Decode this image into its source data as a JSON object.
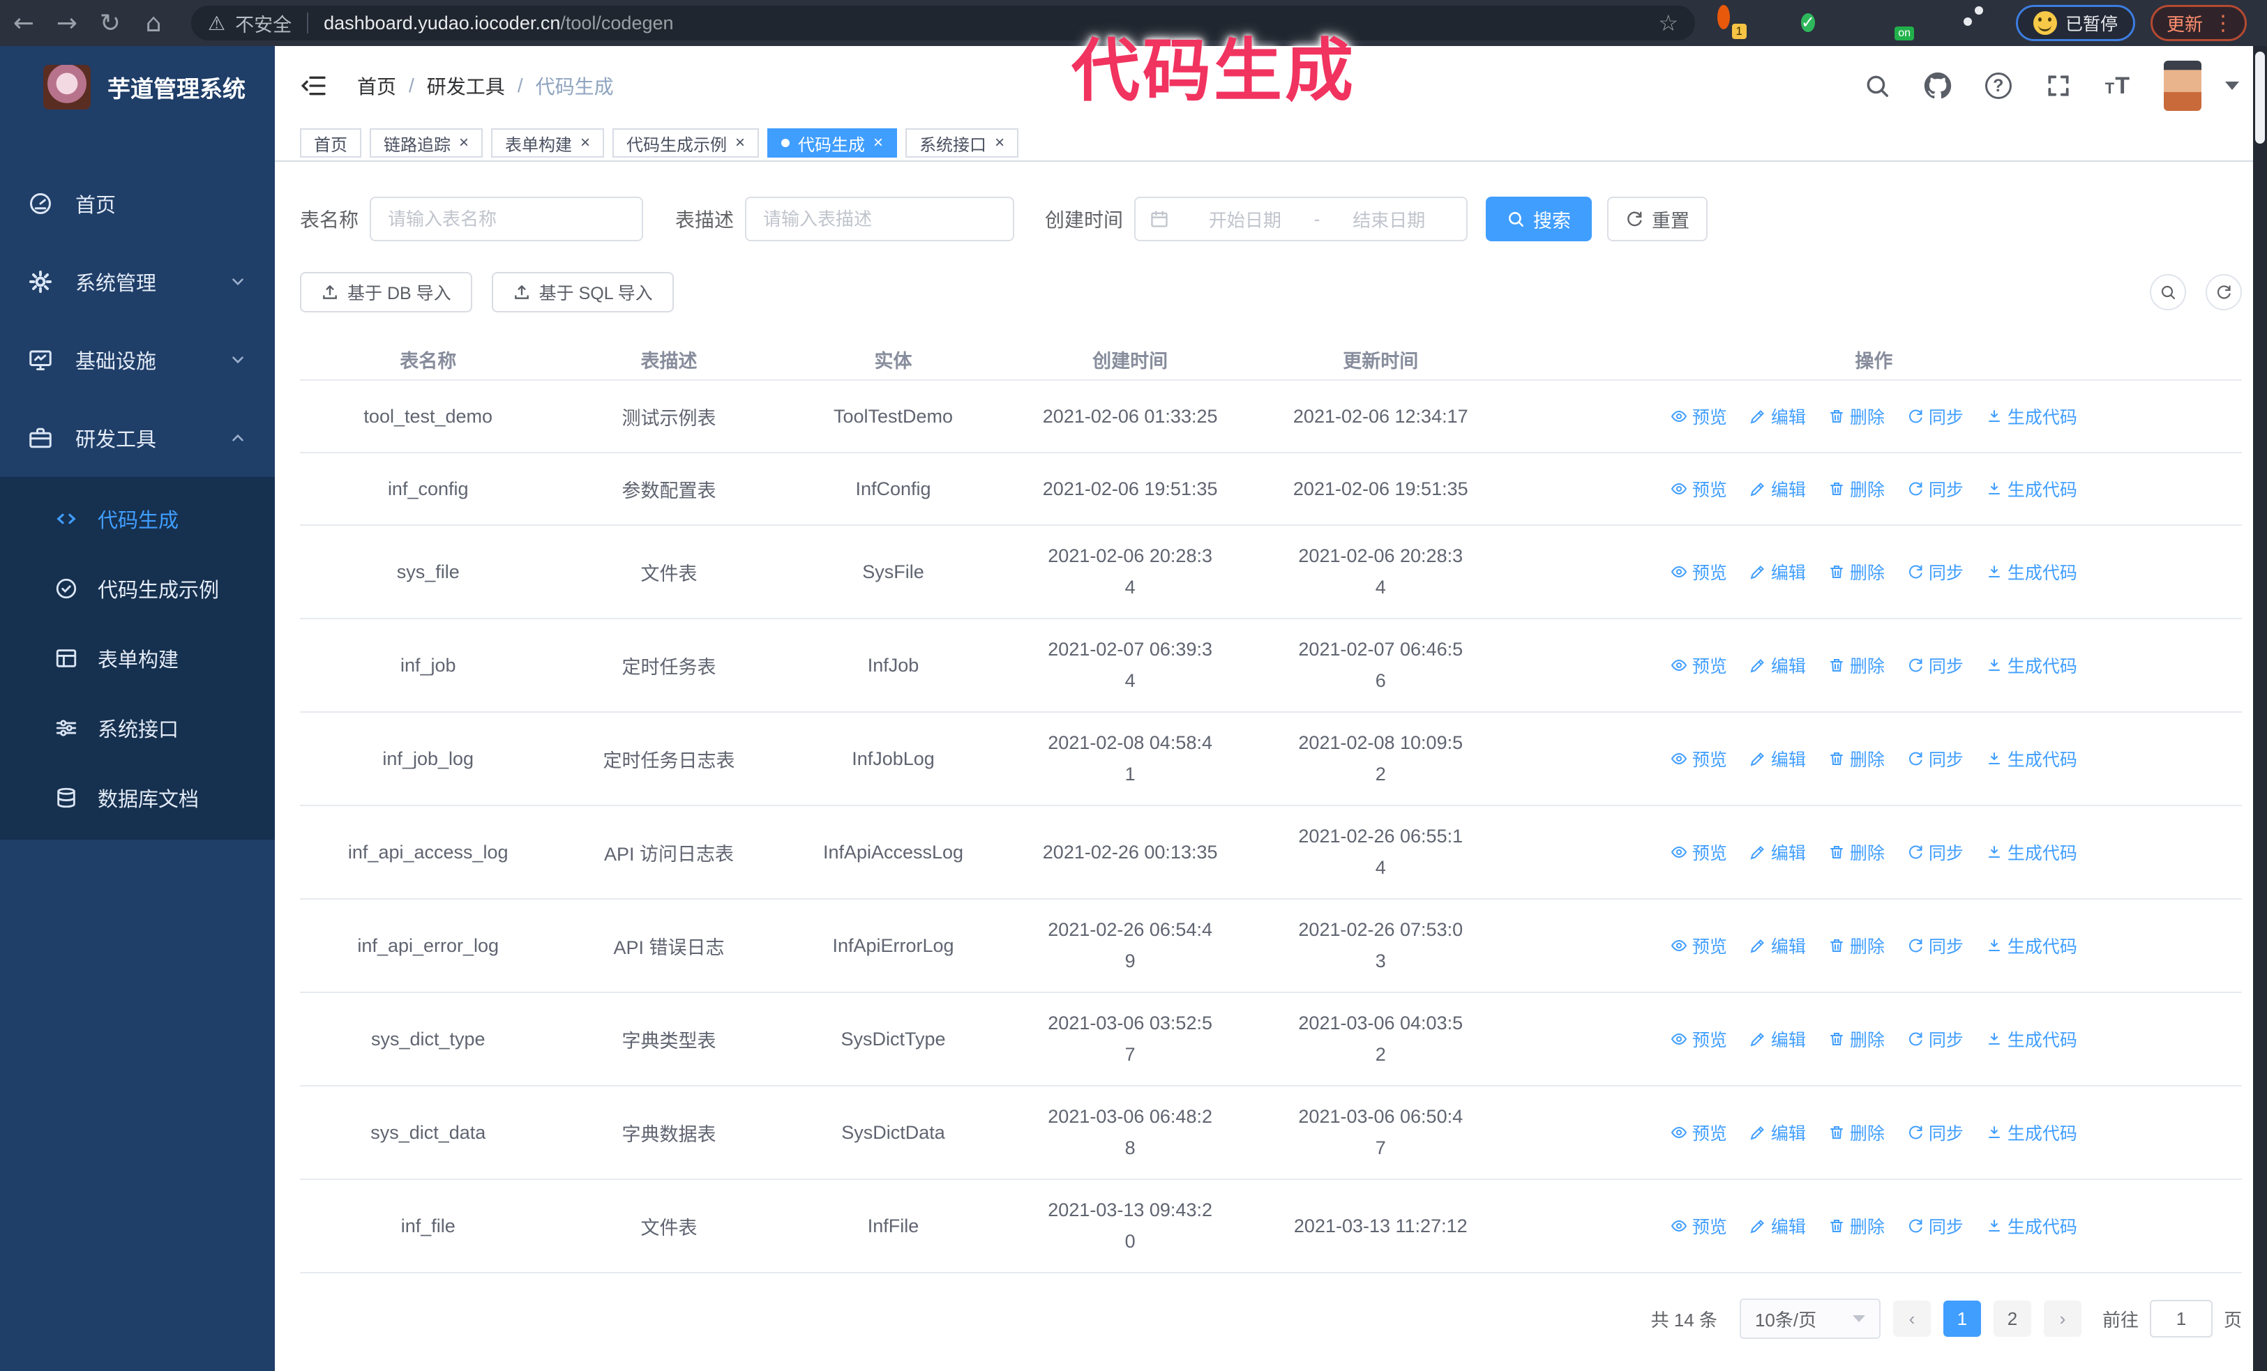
{
  "ui_icons": {
    "back": "←",
    "forward": "→",
    "reload": "↻",
    "home": "⌂",
    "warning": "⚠",
    "star": "☆",
    "more": "⋮",
    "close": "×",
    "prev": "‹",
    "next": "›"
  },
  "browser": {
    "security_warning": "不安全",
    "url_host": "dashboard.yudao.iocoder.cn",
    "url_path": "/tool/codegen",
    "ext_badge_1": "1",
    "ext_badge_on": "on",
    "profile_chip": "已暂停",
    "update_button": "更新"
  },
  "annotation": {
    "text": "代码生成",
    "color": "#f1335f"
  },
  "sidebar": {
    "logo_title": "芋道管理系统",
    "items": [
      {
        "label": "首页"
      },
      {
        "label": "系统管理"
      },
      {
        "label": "基础设施"
      },
      {
        "label": "研发工具"
      }
    ],
    "subitems": [
      {
        "label": "代码生成",
        "active": true
      },
      {
        "label": "代码生成示例"
      },
      {
        "label": "表单构建"
      },
      {
        "label": "系统接口"
      },
      {
        "label": "数据库文档"
      }
    ]
  },
  "header": {
    "breadcrumb": [
      "首页",
      "研发工具",
      "代码生成"
    ],
    "text_size_icon": "TT"
  },
  "tabs": [
    {
      "label": "首页"
    },
    {
      "label": "链路追踪"
    },
    {
      "label": "表单构建"
    },
    {
      "label": "代码生成示例"
    },
    {
      "label": "代码生成"
    },
    {
      "label": "系统接口"
    }
  ],
  "filters": {
    "table_name_label": "表名称",
    "table_name_placeholder": "请输入表名称",
    "table_desc_label": "表描述",
    "table_desc_placeholder": "请输入表描述",
    "create_time_label": "创建时间",
    "start_date_placeholder": "开始日期",
    "range_separator": "-",
    "end_date_placeholder": "结束日期",
    "search_label": "搜索",
    "reset_label": "重置"
  },
  "toolbar": {
    "import_db_label": "基于 DB 导入",
    "import_sql_label": "基于 SQL 导入"
  },
  "table": {
    "columns": [
      "表名称",
      "表描述",
      "实体",
      "创建时间",
      "更新时间",
      "操作"
    ],
    "actions": [
      "预览",
      "编辑",
      "删除",
      "同步",
      "生成代码"
    ],
    "rows": [
      {
        "name": "tool_test_demo",
        "desc": "测试示例表",
        "entity": "ToolTestDemo",
        "created": "2021-02-06 01:33:25",
        "updated": "2021-02-06 12:34:17"
      },
      {
        "name": "inf_config",
        "desc": "参数配置表",
        "entity": "InfConfig",
        "created": "2021-02-06 19:51:35",
        "updated": "2021-02-06 19:51:35"
      },
      {
        "name": "sys_file",
        "desc": "文件表",
        "entity": "SysFile",
        "created": "2021-02-06 20:28:3\n4",
        "updated": "2021-02-06 20:28:3\n4"
      },
      {
        "name": "inf_job",
        "desc": "定时任务表",
        "entity": "InfJob",
        "created": "2021-02-07 06:39:3\n4",
        "updated": "2021-02-07 06:46:5\n6"
      },
      {
        "name": "inf_job_log",
        "desc": "定时任务日志表",
        "entity": "InfJobLog",
        "created": "2021-02-08 04:58:4\n1",
        "updated": "2021-02-08 10:09:5\n2"
      },
      {
        "name": "inf_api_access_log",
        "desc": "API 访问日志表",
        "entity": "InfApiAccessLog",
        "created": "2021-02-26 00:13:35",
        "updated": "2021-02-26 06:55:1\n4"
      },
      {
        "name": "inf_api_error_log",
        "desc": "API 错误日志",
        "entity": "InfApiErrorLog",
        "created": "2021-02-26 06:54:4\n9",
        "updated": "2021-02-26 07:53:0\n3"
      },
      {
        "name": "sys_dict_type",
        "desc": "字典类型表",
        "entity": "SysDictType",
        "created": "2021-03-06 03:52:5\n7",
        "updated": "2021-03-06 04:03:5\n2"
      },
      {
        "name": "sys_dict_data",
        "desc": "字典数据表",
        "entity": "SysDictData",
        "created": "2021-03-06 06:48:2\n8",
        "updated": "2021-03-06 06:50:4\n7"
      },
      {
        "name": "inf_file",
        "desc": "文件表",
        "entity": "InfFile",
        "created": "2021-03-13 09:43:2\n0",
        "updated": "2021-03-13 11:27:12"
      }
    ]
  },
  "pagination": {
    "total": "共 14 条",
    "page_size": "10条/页",
    "pages": [
      "1",
      "2"
    ],
    "active_page": "1",
    "goto_label": "前往",
    "goto_value": "1",
    "goto_suffix": "页"
  }
}
